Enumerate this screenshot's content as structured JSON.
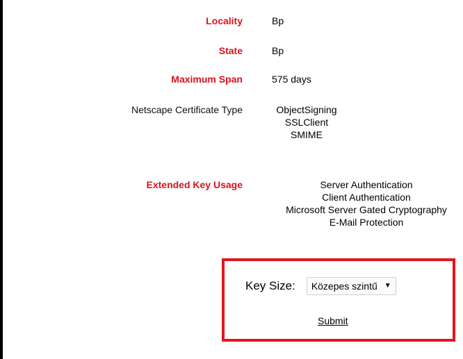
{
  "fields": {
    "locality": {
      "label": "Locality",
      "value": "Bp"
    },
    "state": {
      "label": "State",
      "value": "Bp"
    },
    "maximum_span": {
      "label": "Maximum Span",
      "value": "575 days"
    },
    "netscape_certificate_type": {
      "label": "Netscape Certificate Type",
      "values": [
        "ObjectSigning",
        "SSLClient",
        "SMIME"
      ]
    },
    "extended_key_usage": {
      "label": "Extended Key Usage",
      "values": [
        "Server Authentication",
        "Client Authentication",
        "Microsoft Server Gated Cryptography",
        "E-Mail Protection"
      ]
    }
  },
  "form": {
    "key_size_label": "Key Size:",
    "key_size_selected": "Közepes szintű",
    "submit_label": "Submit"
  },
  "colors": {
    "label_red": "#d9121c",
    "highlight_border": "#e4141c"
  },
  "icons": {
    "select_arrow": "dropdown-arrow-icon"
  }
}
